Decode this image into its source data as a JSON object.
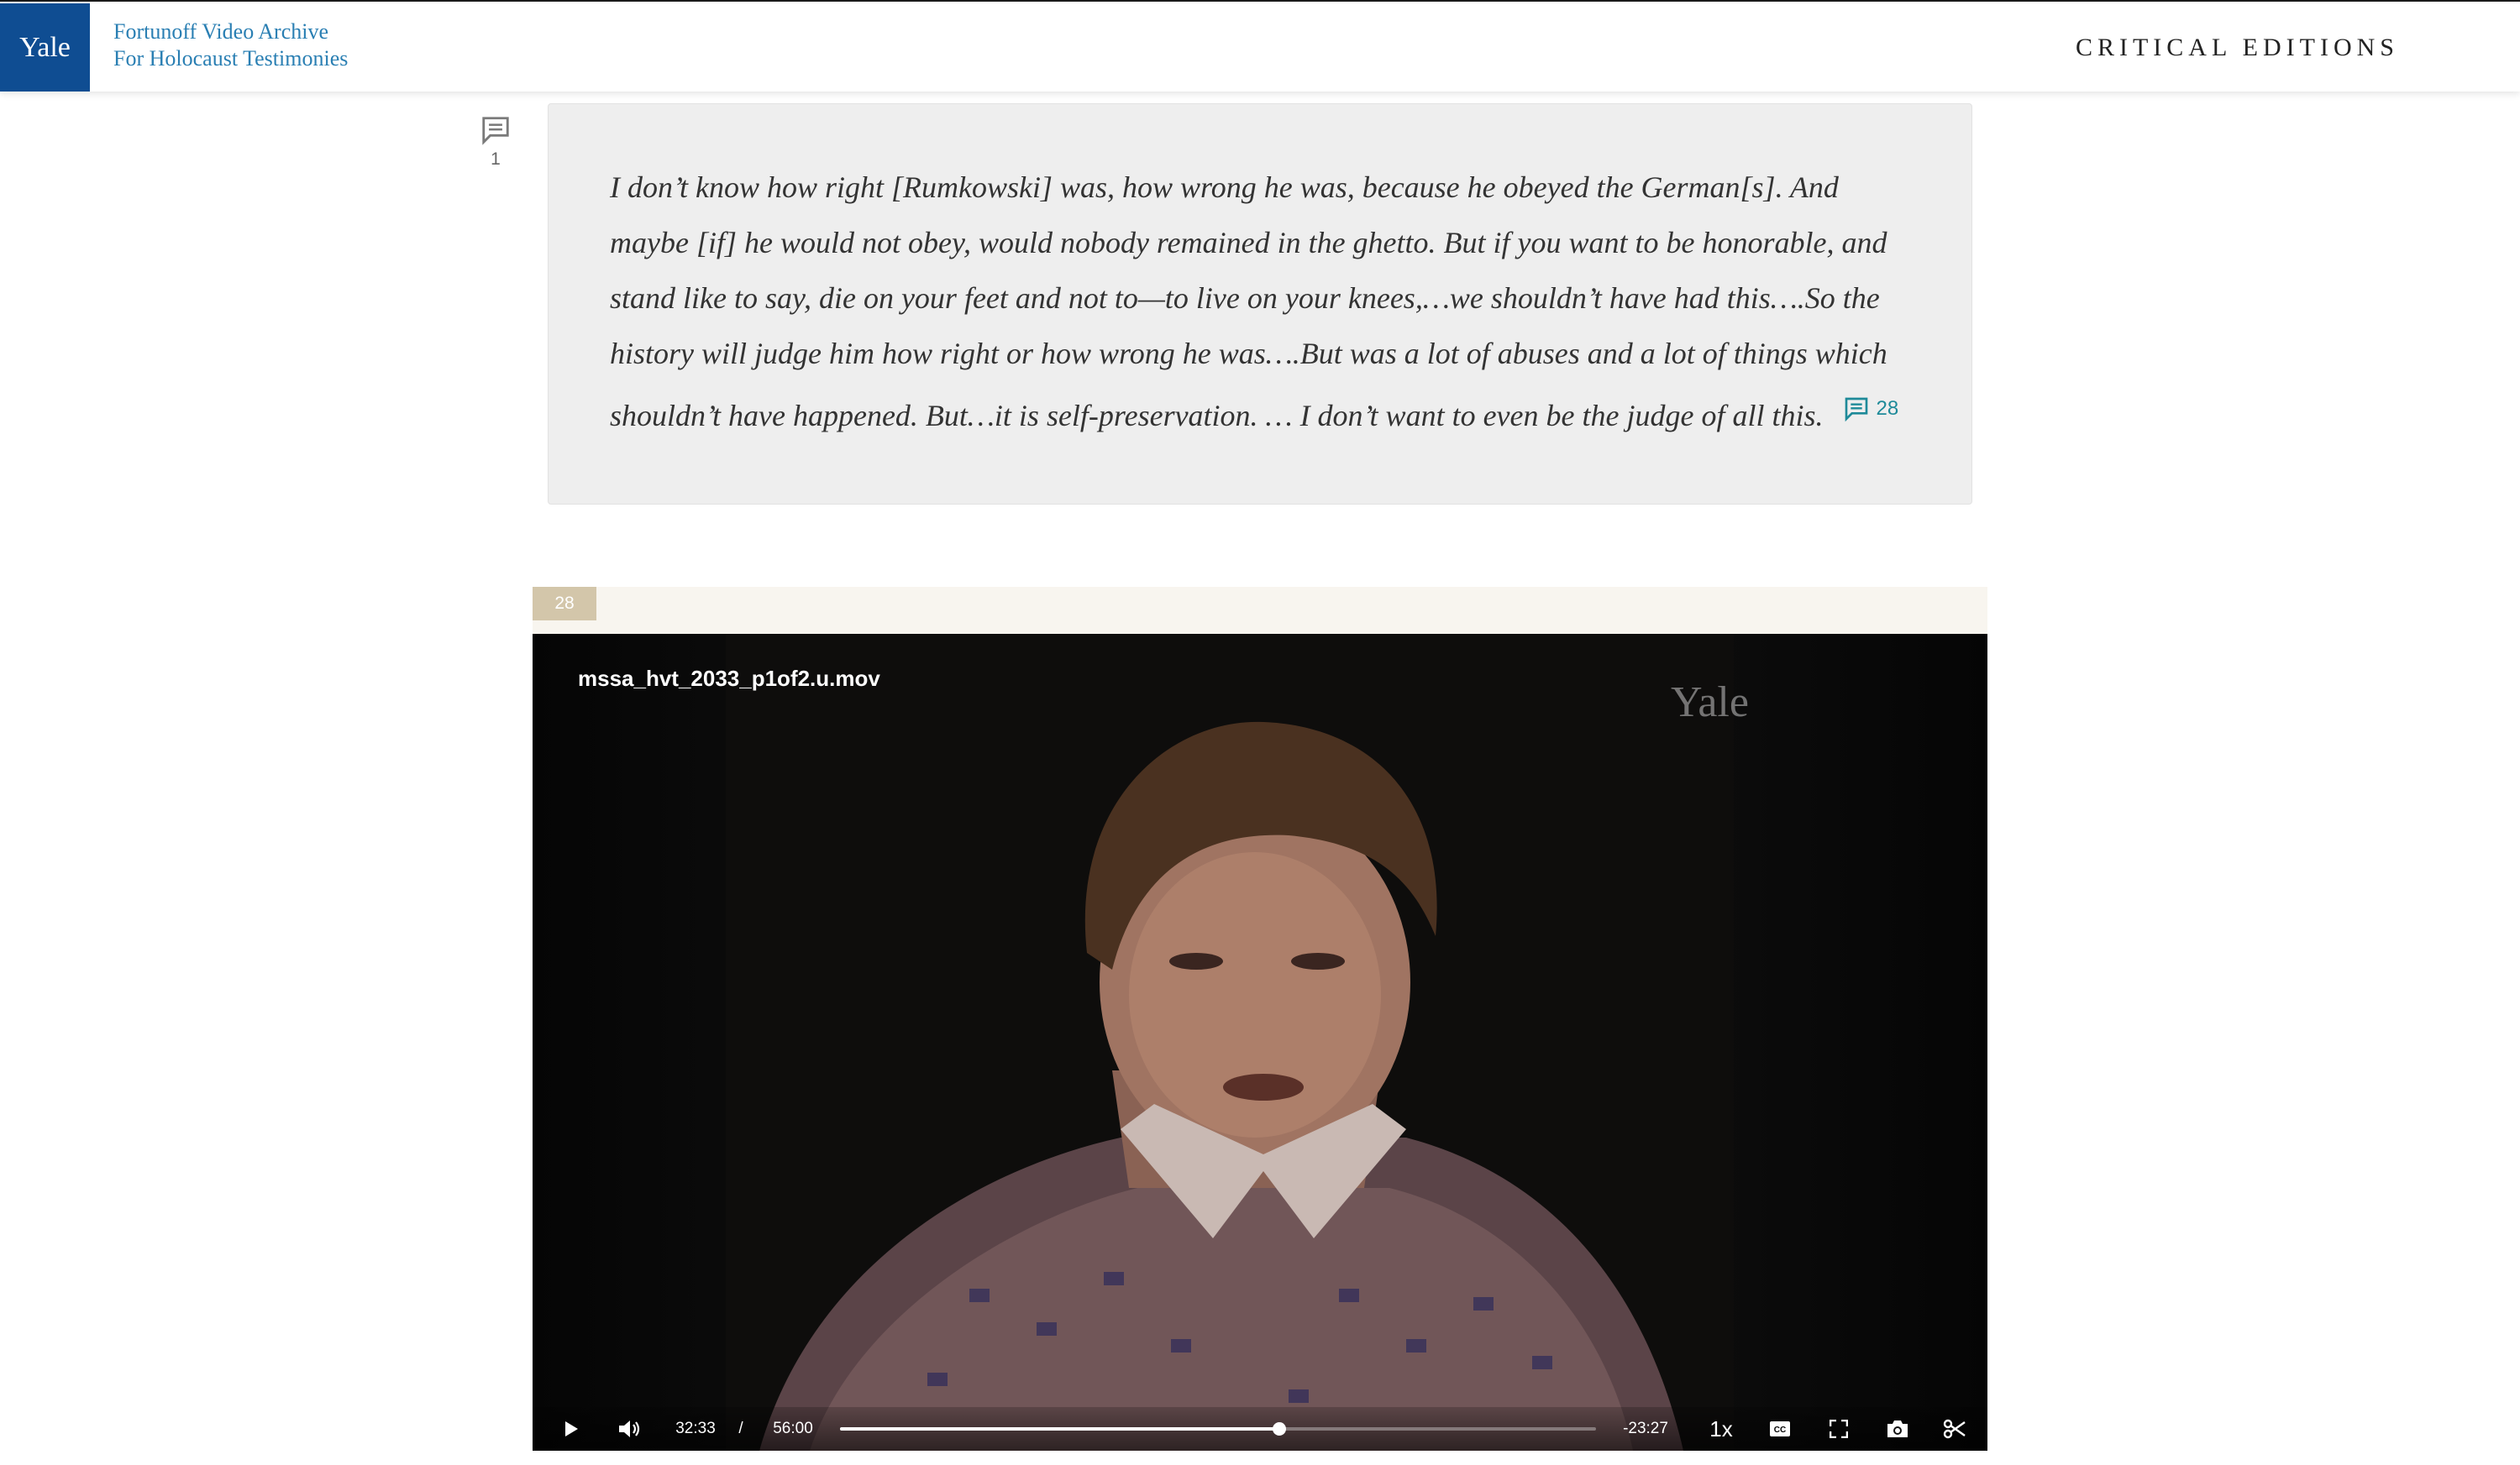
{
  "header": {
    "logo_text": "Yale",
    "archive_line1": "Fortunoff Video Archive",
    "archive_line2": "For Holocaust Testimonies",
    "site_title": "CRITICAL EDITIONS"
  },
  "paragraph_comments": {
    "count": "1",
    "icon": "comment-icon"
  },
  "quote": {
    "text": "I don’t know how right [Rumkowski] was, how wrong he was, because he obeyed the German[s]. And maybe [if] he would not obey, would nobody remained in the ghetto. But if you want to be honorable, and stand like to say, die on your feet and not to—to live on your knees,…we shouldn’t have had this….So the history will judge him how right or how wrong he was….But was a lot of abuses and a lot of things which shouldn’t have happened. But…it is self-preservation. … I don’t want to even be the judge of all this.",
    "ref_number": "28",
    "ref_icon": "comment-icon"
  },
  "clip": {
    "number": "28"
  },
  "video": {
    "filename": "mssa_hvt_2033_p1of2.u.mov",
    "watermark": "Yale",
    "current_time": "32:33",
    "separator": "/",
    "duration": "56:00",
    "remaining": "-23:27",
    "progress_percent": 58.1,
    "speed": "1x",
    "icons": {
      "play": "play-icon",
      "volume": "volume-icon",
      "captions": "closed-captions-icon",
      "fullscreen": "fullscreen-icon",
      "snapshot": "camera-icon",
      "clip": "scissors-icon"
    }
  },
  "colors": {
    "yale_blue": "#0f4d92",
    "link_teal": "#1e8a99",
    "clip_badge": "#d3c6aa"
  }
}
